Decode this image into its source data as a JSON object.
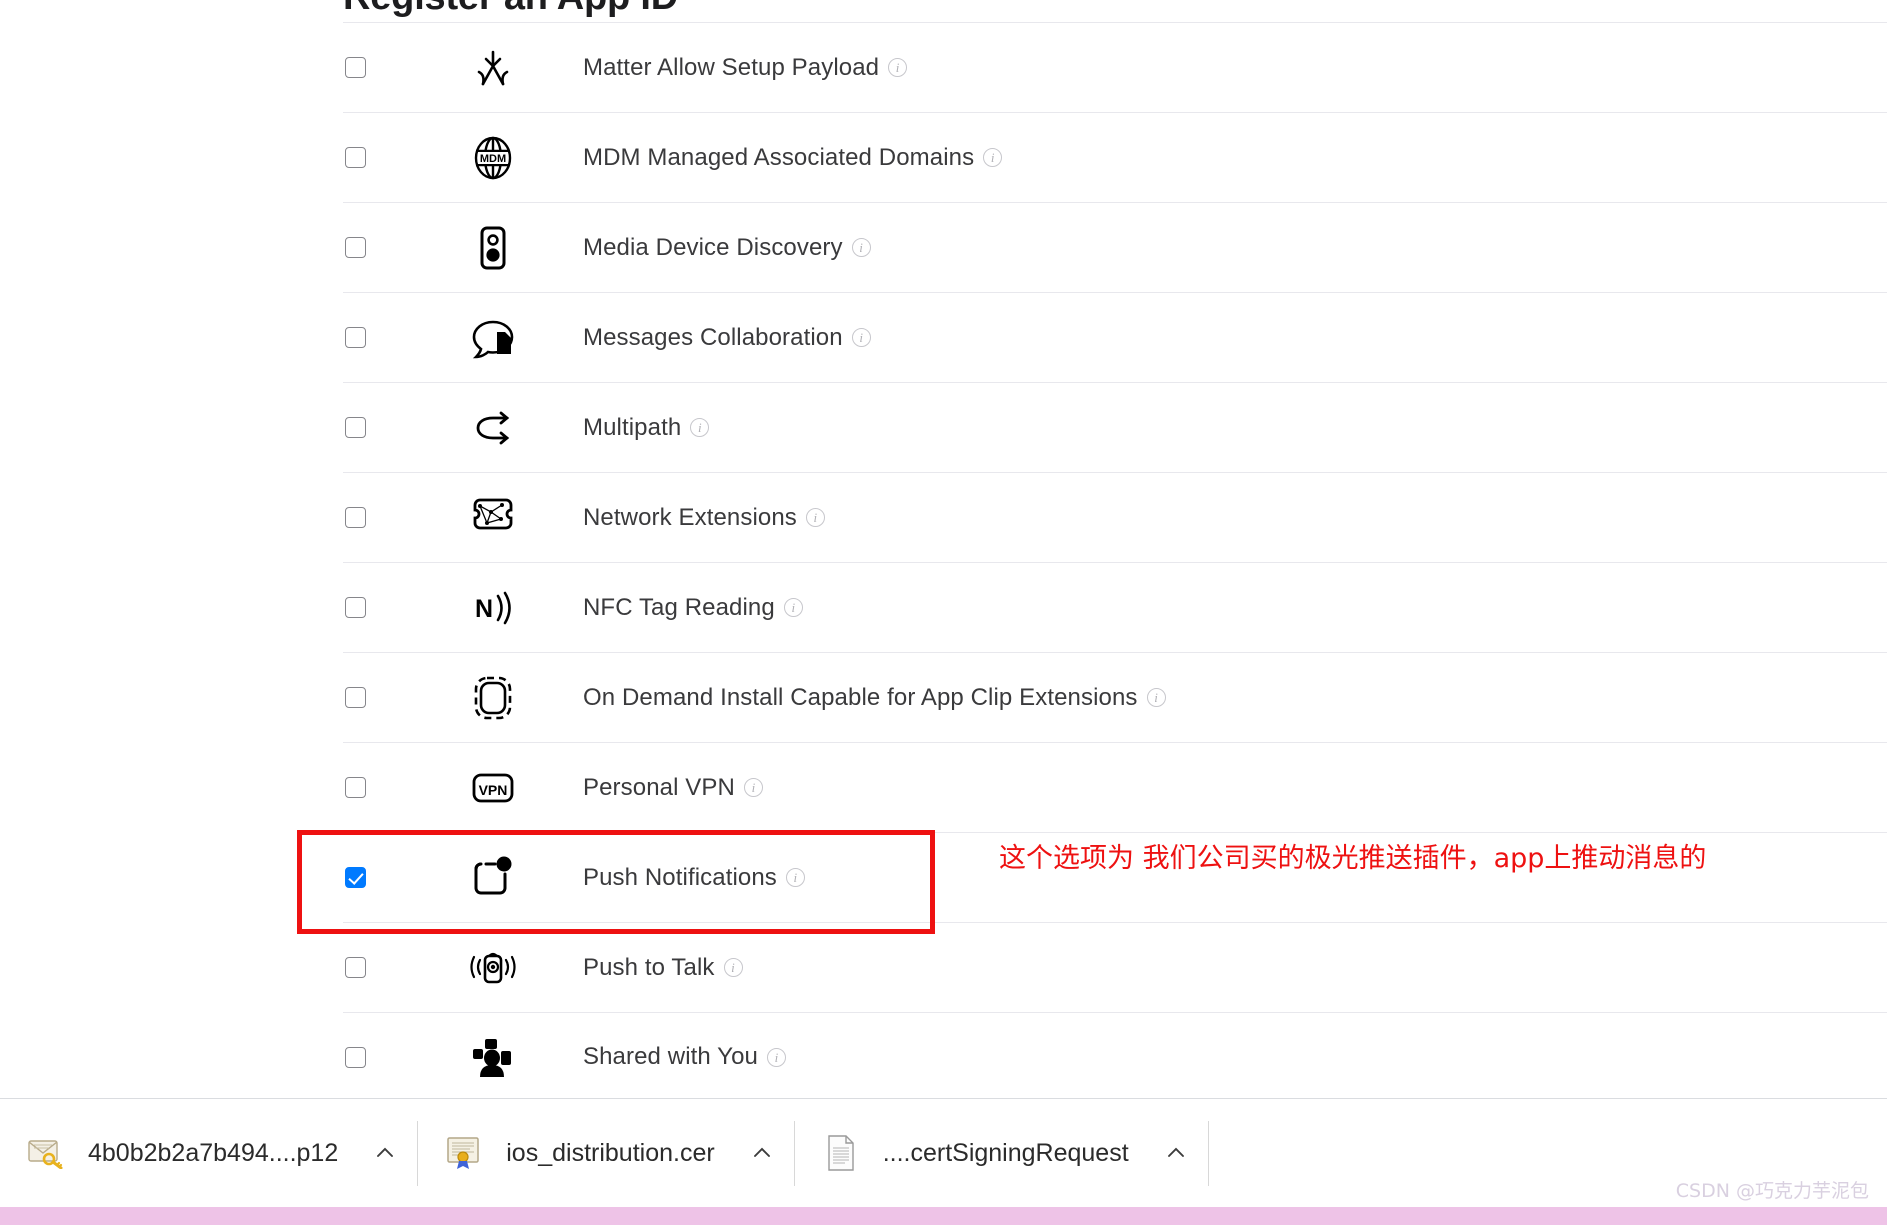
{
  "page": {
    "title": "Register an App ID"
  },
  "capabilities": [
    {
      "label": "Matter Allow Setup Payload",
      "icon": "matter-icon",
      "checked": false,
      "info": "i"
    },
    {
      "label": "MDM Managed Associated Domains",
      "icon": "mdm-globe-icon",
      "checked": false,
      "info": "i"
    },
    {
      "label": "Media Device Discovery",
      "icon": "speaker-icon",
      "checked": false,
      "info": "i"
    },
    {
      "label": "Messages Collaboration",
      "icon": "message-bubble-doc-icon",
      "checked": false,
      "info": "i"
    },
    {
      "label": "Multipath",
      "icon": "multipath-arrows-icon",
      "checked": false,
      "info": "i"
    },
    {
      "label": "Network Extensions",
      "icon": "network-puzzle-icon",
      "checked": false,
      "info": "i"
    },
    {
      "label": "NFC Tag Reading",
      "icon": "nfc-icon",
      "checked": false,
      "info": "i"
    },
    {
      "label": "On Demand Install Capable for App Clip Extensions",
      "icon": "app-clip-dashed-icon",
      "checked": false,
      "info": "i"
    },
    {
      "label": "Personal VPN",
      "icon": "vpn-icon",
      "checked": false,
      "info": "i"
    },
    {
      "label": "Push Notifications",
      "icon": "push-notification-icon",
      "checked": true,
      "info": "i"
    },
    {
      "label": "Push to Talk",
      "icon": "push-to-talk-icon",
      "checked": false,
      "info": "i"
    },
    {
      "label": "Shared with You",
      "icon": "shared-with-you-icon",
      "checked": false,
      "info": "i"
    }
  ],
  "annotation": {
    "text": "这个选项为 我们公司买的极光推送插件，app上推动消息的",
    "color": "#ee1111"
  },
  "highlight": {
    "color": "#ee1111",
    "target_label": "Push Notifications"
  },
  "downloads": [
    {
      "name": "4b0b2b2a7b494....p12",
      "icon": "key-envelope-icon",
      "caret": "chevron-up-icon"
    },
    {
      "name": "ios_distribution.cer",
      "icon": "certificate-icon",
      "caret": "chevron-up-icon"
    },
    {
      "name": "....certSigningRequest",
      "icon": "document-icon",
      "caret": "chevron-up-icon"
    }
  ],
  "watermark": {
    "text": "CSDN @巧克力芋泥包"
  }
}
